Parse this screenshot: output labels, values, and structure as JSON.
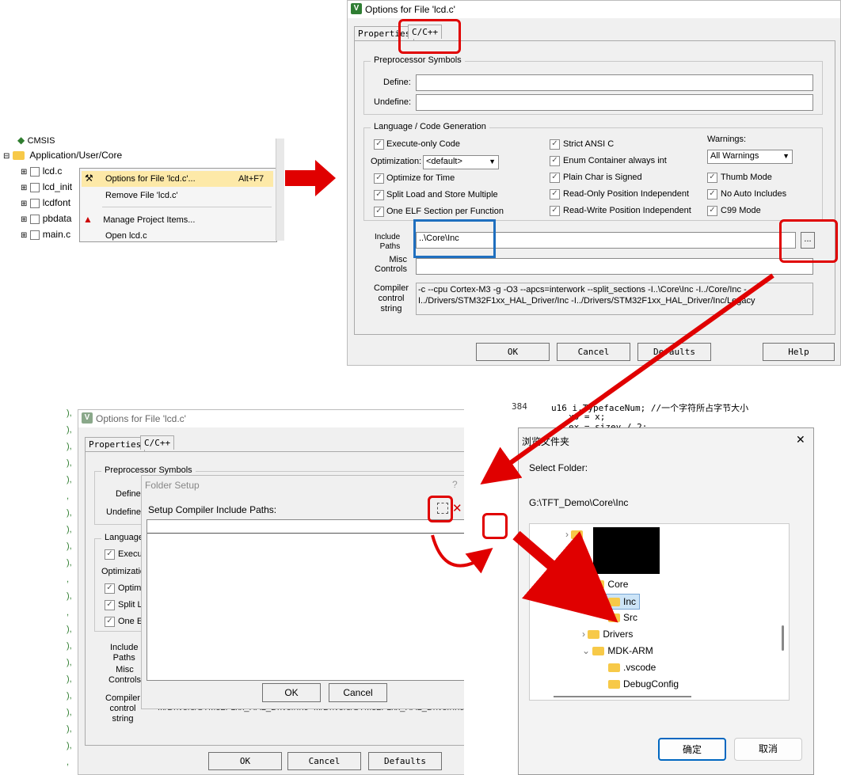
{
  "tree": {
    "cmsis": "CMSIS",
    "group": "Application/User/Core",
    "files": [
      "lcd.c",
      "lcd_init",
      "lcdfont",
      "pbdata",
      "main.c"
    ]
  },
  "context_menu": {
    "options": "Options for File 'lcd.c'...",
    "options_shortcut": "Alt+F7",
    "remove": "Remove File 'lcd.c'",
    "manage": "Manage Project Items...",
    "open": "Open lcd.c"
  },
  "dlg1": {
    "title": "Options for File 'lcd.c'",
    "tabs": [
      "Properties",
      "C/C++"
    ],
    "preproc_title": "Preprocessor Symbols",
    "define_label": "Define:",
    "undefine_label": "Undefine:",
    "lang_title": "Language / Code Generation",
    "left_checks": [
      "Execute-only Code",
      "Optimize for Time",
      "Split Load and Store Multiple",
      "One ELF Section per Function"
    ],
    "optimization_label": "Optimization:",
    "optimization_value": "<default>",
    "mid_checks": [
      "Strict ANSI C",
      "Enum Container always int",
      "Plain Char is Signed",
      "Read-Only Position Independent",
      "Read-Write Position Independent"
    ],
    "warnings_label": "Warnings:",
    "warnings_value": "All Warnings",
    "right_checks": [
      "Thumb Mode",
      "No Auto Includes",
      "C99 Mode"
    ],
    "include_label": "Include\nPaths",
    "include_value": "..\\Core\\Inc",
    "misc_label": "Misc\nControls",
    "compiler_label": "Compiler\ncontrol\nstring",
    "compiler_value": "-c --cpu Cortex-M3 -g -O3 --apcs=interwork --split_sections -I..\\Core\\Inc -I../Core/Inc -I../Drivers/STM32F1xx_HAL_Driver/Inc -I../Drivers/STM32F1xx_HAL_Driver/Inc/Legacy",
    "browse": "...",
    "ok": "OK",
    "cancel": "Cancel",
    "defaults": "Defaults",
    "help": "Help"
  },
  "dlg2": {
    "title": "Options for File 'lcd.c'",
    "tabs": [
      "Properties",
      "C/C++"
    ],
    "preproc_title": "Preprocessor Symbols",
    "define_label": "Define:",
    "undefine_label": "Undefine:",
    "lang_title": "Language",
    "checks": [
      "Execu",
      "Optimi",
      "Split L",
      "One E"
    ],
    "optimization_label": "Optimization",
    "include_label": "Include\nPaths",
    "misc_label": "Misc\nControls",
    "compiler_label": "Compiler\ncontrol\nstring",
    "compiler_value": "I../Drivers/STM32F1xx_HAL_Driver/Inc -I../Drivers/STM32F1xx_HAL_Driver/Inc/Legacy",
    "ok": "OK",
    "cancel": "Cancel",
    "defaults": "Defaults"
  },
  "folder_setup": {
    "title": "Folder Setup",
    "help": "?",
    "close": "✕",
    "label": "Setup Compiler Include Paths:",
    "browse": "...",
    "ok": "OK",
    "cancel": "Cancel"
  },
  "code": {
    "line_no": "384",
    "lines": [
      "u16 i,TypefaceNum; //一个字符所占字节大小",
      "x0 = x;",
      "ex = sizey / 2;"
    ]
  },
  "browse_dialog": {
    "title": "浏览文件夹",
    "close": "✕",
    "select_label": "Select Folder:",
    "path": "G:\\TFT_Demo\\Core\\Inc",
    "folders": [
      "Core",
      "Inc",
      "Src",
      "Drivers",
      "MDK-ARM",
      ".vscode",
      "DebugConfig"
    ],
    "ok": "确定",
    "cancel": "取消"
  },
  "colors": {
    "annotation_red": "#e00000",
    "annotation_blue": "#1f6fbf",
    "folder": "#f7c948",
    "selection": "#cce4f7"
  }
}
